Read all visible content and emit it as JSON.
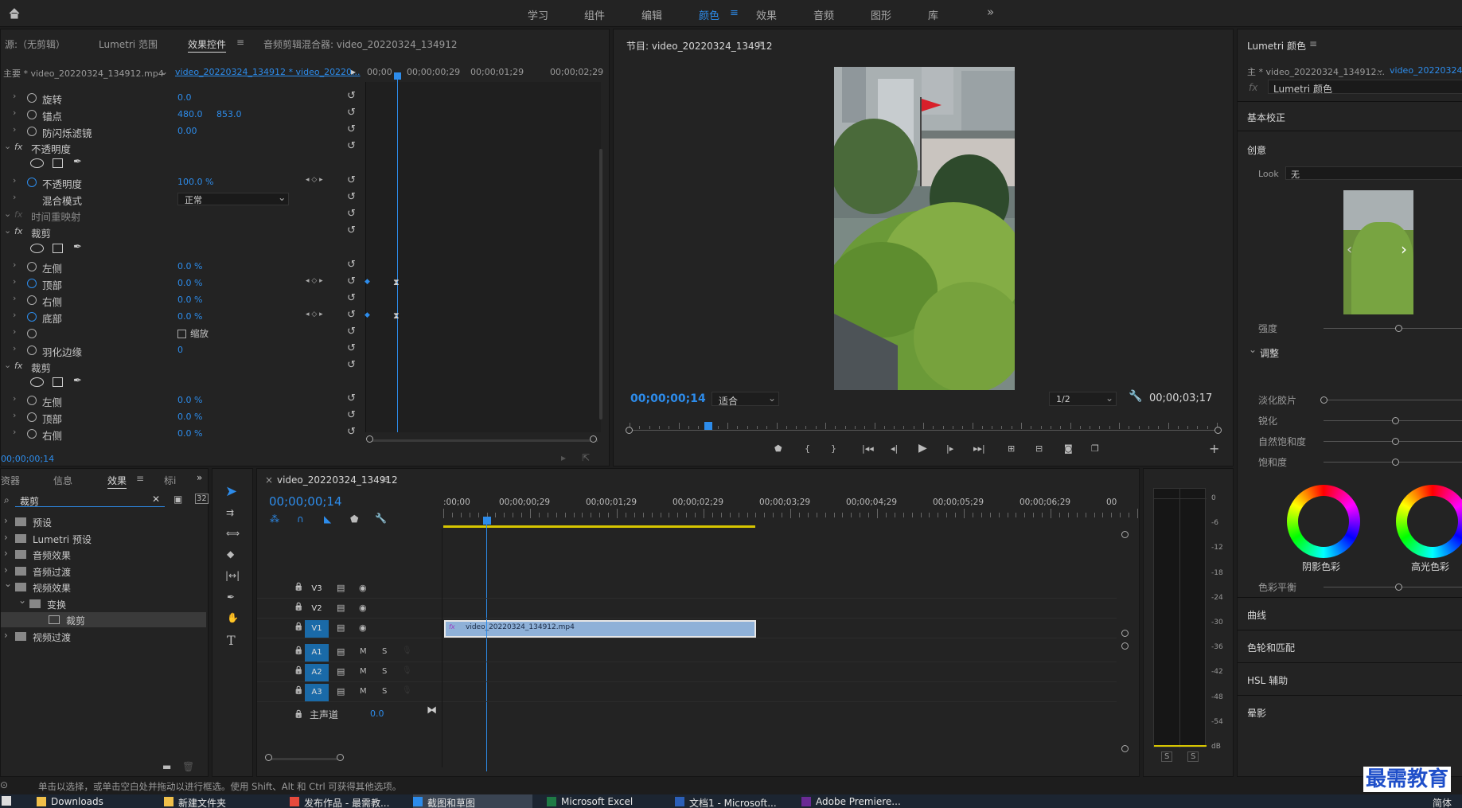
{
  "workspaces": [
    "学习",
    "组件",
    "编辑",
    "颜色",
    "效果",
    "音频",
    "图形",
    "库"
  ],
  "active_workspace": "颜色",
  "workspaces_more": "»",
  "left_panel": {
    "tabs": [
      "源:（无剪辑）",
      "Lumetri 范围",
      "效果控件",
      "音频剪辑混合器: video_20220324_134912"
    ],
    "active_tab": "效果控件",
    "master": "主要 * video_20220324_134912.mp4",
    "sequence": "video_20220324_134912 * video_20220...",
    "ruler": [
      "00;00",
      "00;00;00;29",
      "00;00;01;29",
      "00;00;02;29"
    ],
    "timecode": "00;00;00;14",
    "rows": [
      {
        "label": "旋转",
        "v1": "0.0"
      },
      {
        "label": "锚点",
        "v1": "480.0",
        "v2": "853.0"
      },
      {
        "label": "防闪烁滤镜",
        "v1": "0.00"
      },
      {
        "label": "不透明度",
        "section": true
      },
      {
        "label": "不透明度",
        "v1": "100.0 %"
      },
      {
        "label": "混合模式",
        "v1": "正常"
      },
      {
        "label": "时间重映射",
        "section": true
      },
      {
        "label": "裁剪",
        "section": true
      },
      {
        "label": "左侧",
        "v1": "0.0 %"
      },
      {
        "label": "顶部",
        "v1": "0.0 %"
      },
      {
        "label": "右侧",
        "v1": "0.0 %"
      },
      {
        "label": "底部",
        "v1": "0.0 %"
      },
      {
        "label": "缩放"
      },
      {
        "label": "羽化边缘",
        "v1": "0"
      },
      {
        "label": "裁剪",
        "section": true
      },
      {
        "label": "左侧",
        "v1": "0.0 %"
      },
      {
        "label": "顶部",
        "v1": "0.0 %"
      },
      {
        "label": "右侧",
        "v1": "0.0 %"
      },
      {
        "label": "底部",
        "v1": "0.0 %"
      }
    ]
  },
  "program": {
    "title": "节目: video_20220324_134912",
    "timecode": "00;00;00;14",
    "fit": "适合",
    "resolution": "1/2",
    "duration": "00;00;03;17"
  },
  "lumetri": {
    "title": "Lumetri 颜色",
    "master": "主 * video_20220324_134912...",
    "clip": "video_20220324_1",
    "fx": "Lumetri 颜色",
    "basic": "基本校正",
    "creative": "创意",
    "look_label": "Look",
    "look_value": "无",
    "intensity": "强度",
    "adjust": "调整",
    "sliders": [
      "淡化胶片",
      "锐化",
      "自然饱和度",
      "饱和度"
    ],
    "wheel1": "阴影色彩",
    "wheel2": "高光色彩",
    "balance": "色彩平衡",
    "sections": [
      "曲线",
      "色轮和匹配",
      "HSL 辅助",
      "晕影"
    ]
  },
  "effects_panel": {
    "tabs": [
      "资器",
      "信息",
      "效果",
      "标i"
    ],
    "search_value": "裁剪",
    "tree": [
      {
        "label": "预设",
        "level": 0
      },
      {
        "label": "Lumetri 预设",
        "level": 0
      },
      {
        "label": "音频效果",
        "level": 0
      },
      {
        "label": "音频过渡",
        "level": 0
      },
      {
        "label": "视频效果",
        "level": 0
      },
      {
        "label": "变换",
        "level": 1
      },
      {
        "label": "裁剪",
        "level": 2
      },
      {
        "label": "视频过渡",
        "level": 0
      }
    ]
  },
  "timeline": {
    "title": "video_20220324_134912",
    "timecode": "00;00;00;14",
    "ruler": [
      ":00;00",
      "00;00;00;29",
      "00;00;01;29",
      "00;00;02;29",
      "00;00;03;29",
      "00;00;04;29",
      "00;00;05;29",
      "00;00;06;29",
      "00"
    ],
    "video_tracks": [
      "V3",
      "V2",
      "V1"
    ],
    "audio_tracks": [
      "A1",
      "A2",
      "A3"
    ],
    "master": "主声道",
    "master_value": "0.0",
    "clip": "video_20220324_134912.mp4"
  },
  "meter": {
    "labels": [
      "0",
      "-6",
      "-12",
      "-18",
      "-24",
      "-30",
      "-36",
      "-42",
      "-48",
      "-54",
      "dB"
    ],
    "solo": [
      "S",
      "S"
    ]
  },
  "status": "单击以选择，或单击空白处并拖动以进行框选。使用 Shift、Alt 和 Ctrl 可获得其他选项。",
  "taskbar": [
    "Downloads",
    "新建文件夹",
    "发布作品 - 最需教...",
    "截图和草图",
    "Microsoft Excel",
    "文档1 - Microsoft...",
    "Adobe Premiere..."
  ],
  "tray": "简体",
  "watermark": "最需教育"
}
